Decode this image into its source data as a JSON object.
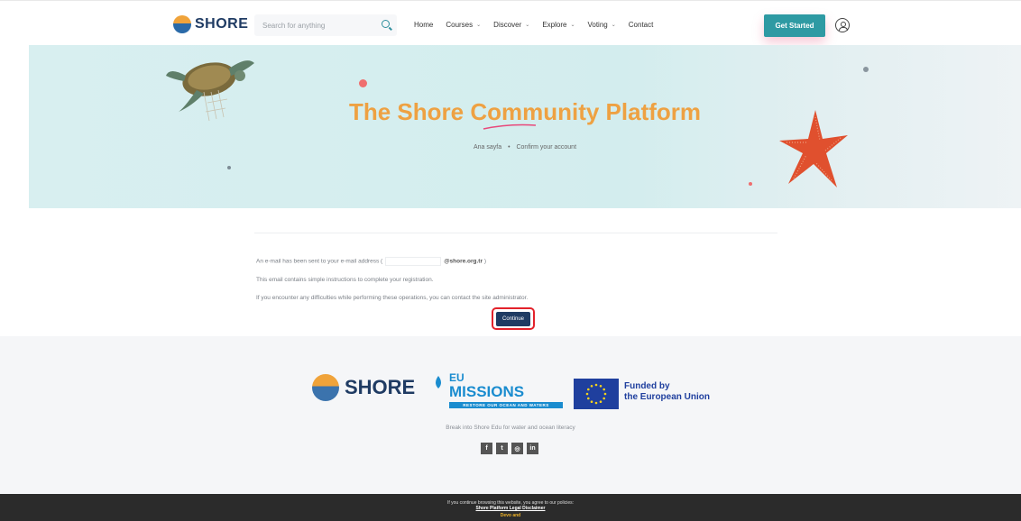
{
  "header": {
    "logo_text": "SHORE",
    "search_placeholder": "Search for anything",
    "nav": [
      {
        "label": "Home",
        "has_dropdown": false
      },
      {
        "label": "Courses",
        "has_dropdown": true
      },
      {
        "label": "Discover",
        "has_dropdown": true
      },
      {
        "label": "Explore",
        "has_dropdown": true
      },
      {
        "label": "Voting",
        "has_dropdown": true
      },
      {
        "label": "Contact",
        "has_dropdown": false
      }
    ],
    "cta": "Get Started",
    "icons": {
      "search": "search-icon",
      "user": "user-icon",
      "chevron": "chevron-down-icon"
    }
  },
  "hero": {
    "title": "The Shore Community Platform",
    "breadcrumb": {
      "home": "Ana sayfa",
      "separator": "•",
      "current": "Confirm your account"
    },
    "title_color": "#eea142"
  },
  "content": {
    "line1_prefix": "An e-mail has been sent to your e-mail address (",
    "email_domain": "@shore.org.tr",
    "line1_suffix": ")",
    "line2": "This email contains simple instructions to complete your registration.",
    "line3": "If you encounter any difficulties while performing these operations, you can contact the site administrator.",
    "continue_label": "Continue"
  },
  "footer": {
    "shore_text": "SHORE",
    "missions_eu": "EU",
    "missions_word": "MISSIONS",
    "missions_sub": "RESTORE OUR OCEAN AND WATERS",
    "funded_line1": "Funded by",
    "funded_line2": "the European Union",
    "tagline": "Break into Shore Edu for water and ocean literacy",
    "socials": [
      {
        "icon": "facebook-icon",
        "glyph": "f"
      },
      {
        "icon": "twitter-icon",
        "glyph": "t"
      },
      {
        "icon": "instagram-icon",
        "glyph": "◎"
      },
      {
        "icon": "linkedin-icon",
        "glyph": "in"
      }
    ]
  },
  "cookie_bar": {
    "text": "If you continue browsing this website, you agree to our policies:",
    "link": "Shore Platform Legal Disclaimer",
    "button": "Devo and"
  },
  "colors": {
    "accent": "#2e9aa3",
    "navy": "#1f3b63",
    "continue_highlight": "#e3222b"
  }
}
